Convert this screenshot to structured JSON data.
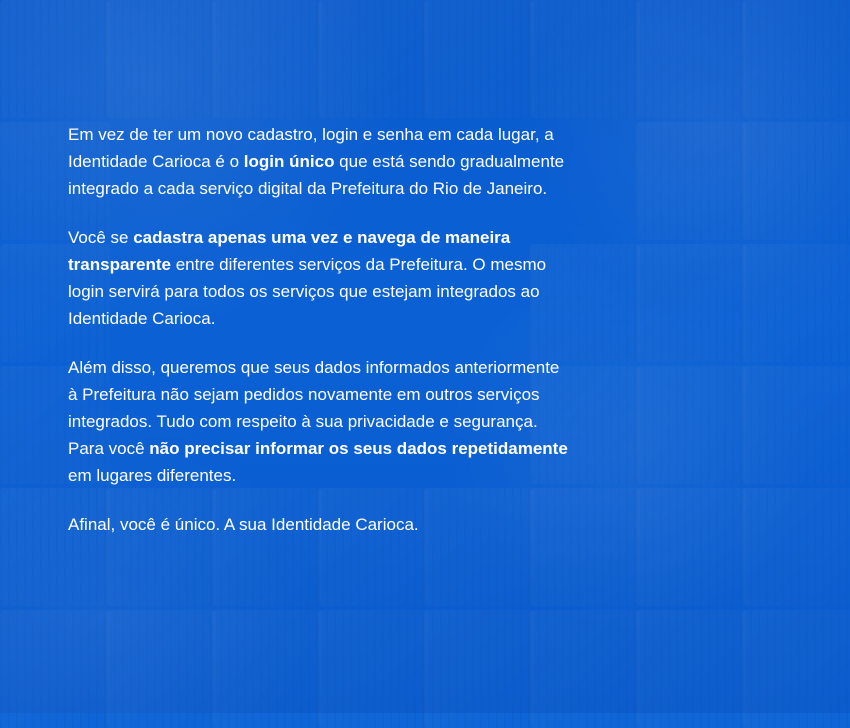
{
  "colors": {
    "background": "#0b63d6",
    "text": "#ffffff"
  },
  "content": {
    "paragraph1": {
      "part1": "Em vez de ter um novo cadastro, login e senha em cada lugar, a Identidade Carioca é o ",
      "bold": "login único",
      "part2": " que está sendo gradualmente integrado a cada serviço digital da Prefeitura do Rio de Janeiro."
    },
    "paragraph2": {
      "part1": "Você se ",
      "bold1": "cadastra apenas uma vez e navega de maneira transparente",
      "part2": " entre diferentes serviços da Prefeitura. O mesmo login servirá para todos os serviços que estejam integrados ao Identidade Carioca."
    },
    "paragraph3": {
      "part1": "Além disso, queremos que seus dados informados anteriormente à Prefeitura não sejam pedidos novamente em outros serviços integrados. Tudo com respeito à sua privacidade e segurança. Para você ",
      "bold1": "não precisar informar os seus dados repetidamente",
      "part2": " em lugares diferentes."
    },
    "paragraph4": {
      "text": "Afinal, você é único. A sua Identidade Carioca."
    }
  }
}
